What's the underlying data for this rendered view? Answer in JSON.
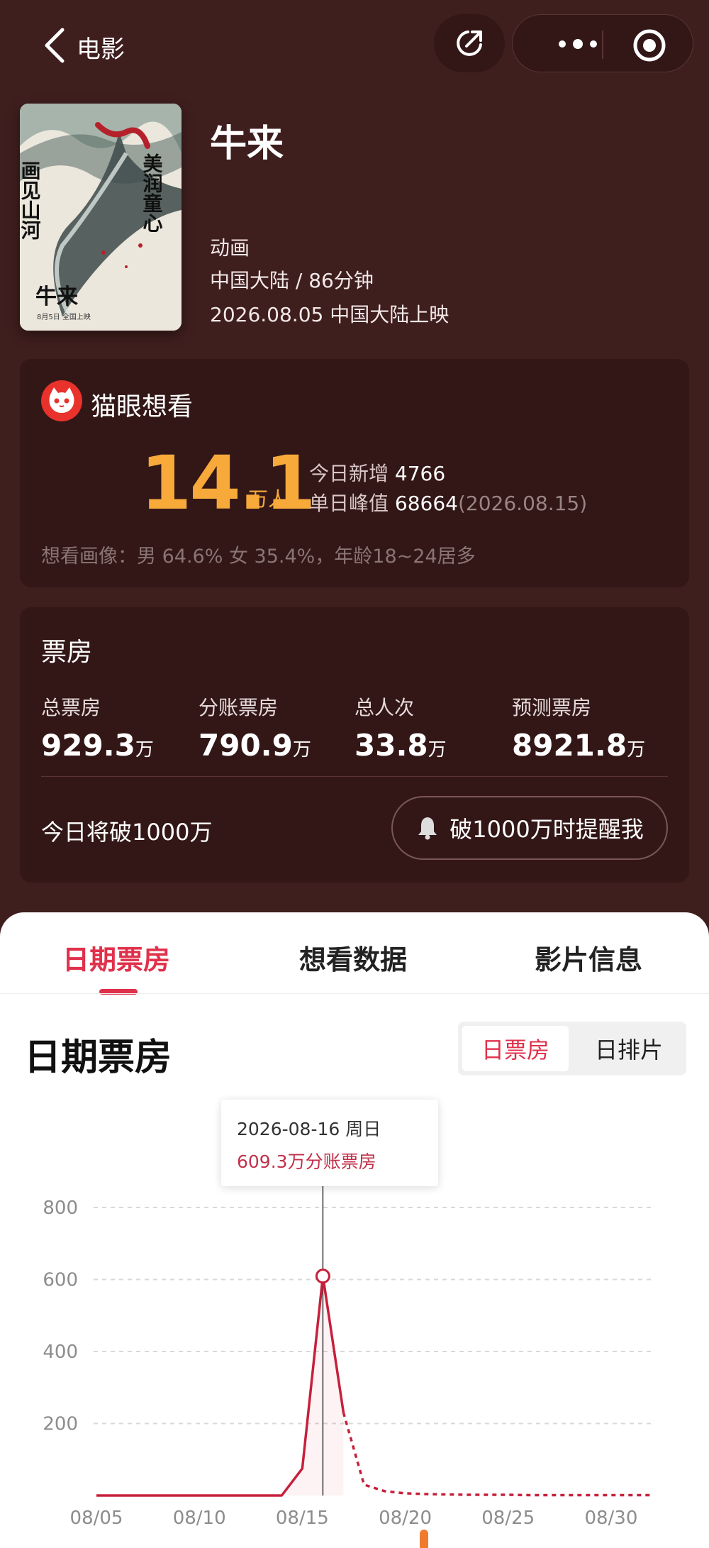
{
  "nav": {
    "title": "电影",
    "icons": [
      "back-icon",
      "share-icon",
      "more-icon",
      "target-icon"
    ]
  },
  "poster": {
    "calligraphy_left": "画见山河",
    "calligraphy_right": "美润童心",
    "title_mark": "牛来",
    "date_text": "8月5日 全国上映"
  },
  "movie": {
    "title": "牛来",
    "genre": "动画",
    "region_duration": "中国大陆 / 86分钟",
    "release": "2026.08.05 中国大陆上映"
  },
  "want": {
    "brand": "猫眼想看",
    "count": "14.1",
    "unit": "万人",
    "today_label": "今日新增",
    "today_value": "4766",
    "peak_label": "单日峰值",
    "peak_value": "68664",
    "peak_date": "(2026.08.15)",
    "portrait": "想看画像：男 64.6% 女 35.4%，年龄18~24居多"
  },
  "box": {
    "title": "票房",
    "stats": [
      {
        "label": "总票房",
        "value": "929.3",
        "unit": "万"
      },
      {
        "label": "分账票房",
        "value": "790.9",
        "unit": "万"
      },
      {
        "label": "总人次",
        "value": "33.8",
        "unit": "万"
      },
      {
        "label": "预测票房",
        "value": "8921.8",
        "unit": "万"
      }
    ],
    "break_text": "今日将破1000万",
    "remind_label": "破1000万时提醒我"
  },
  "tabs": [
    {
      "label": "日期票房",
      "active": true
    },
    {
      "label": "想看数据",
      "active": false
    },
    {
      "label": "影片信息",
      "active": false
    }
  ],
  "chart_section": {
    "title": "日期票房",
    "toggle": [
      {
        "label": "日票房",
        "active": true
      },
      {
        "label": "日排片",
        "active": false
      }
    ]
  },
  "tooltip": {
    "date": "2026-08-16 周日",
    "value": "609.3万分账票房"
  },
  "colors": {
    "accent": "#e0314b",
    "gold": "#f7a93a",
    "background": "#3f1e1e",
    "card": "#331717"
  },
  "chart_data": {
    "type": "line",
    "title": "日期票房",
    "xlabel": "",
    "ylabel": "",
    "ylim": [
      0,
      800
    ],
    "yticks": [
      200,
      400,
      600,
      800
    ],
    "xticks": [
      "08/05",
      "08/10",
      "08/15",
      "08/20",
      "08/25",
      "08/30"
    ],
    "grid": true,
    "series": [
      {
        "values": [
          {
            "x": "08/05",
            "y": 0
          },
          {
            "x": "08/06",
            "y": 0
          },
          {
            "x": "08/07",
            "y": 0
          },
          {
            "x": "08/08",
            "y": 0
          },
          {
            "x": "08/09",
            "y": 0
          },
          {
            "x": "08/10",
            "y": 0
          },
          {
            "x": "08/11",
            "y": 0
          },
          {
            "x": "08/12",
            "y": 0
          },
          {
            "x": "08/13",
            "y": 0
          },
          {
            "x": "08/14",
            "y": 0
          },
          {
            "x": "08/15",
            "y": 75
          },
          {
            "x": "08/16",
            "y": 609.3
          },
          {
            "x": "08/17",
            "y": 230
          }
        ]
      },
      {
        "style": "dashed",
        "values": [
          {
            "x": "08/17",
            "y": 230
          },
          {
            "x": "08/18",
            "y": 30
          },
          {
            "x": "08/19",
            "y": 12
          },
          {
            "x": "08/20",
            "y": 6
          },
          {
            "x": "08/21",
            "y": 4
          },
          {
            "x": "08/22",
            "y": 3
          },
          {
            "x": "08/23",
            "y": 2
          },
          {
            "x": "08/24",
            "y": 2
          },
          {
            "x": "08/25",
            "y": 2
          },
          {
            "x": "08/26",
            "y": 1
          },
          {
            "x": "08/27",
            "y": 1
          },
          {
            "x": "08/28",
            "y": 1
          },
          {
            "x": "08/29",
            "y": 1
          },
          {
            "x": "08/30",
            "y": 1
          },
          {
            "x": "08/31",
            "y": 1
          },
          {
            "x": "09/01",
            "y": 1
          }
        ]
      }
    ],
    "highlight": {
      "x": "08/16",
      "y": 609.3
    }
  }
}
